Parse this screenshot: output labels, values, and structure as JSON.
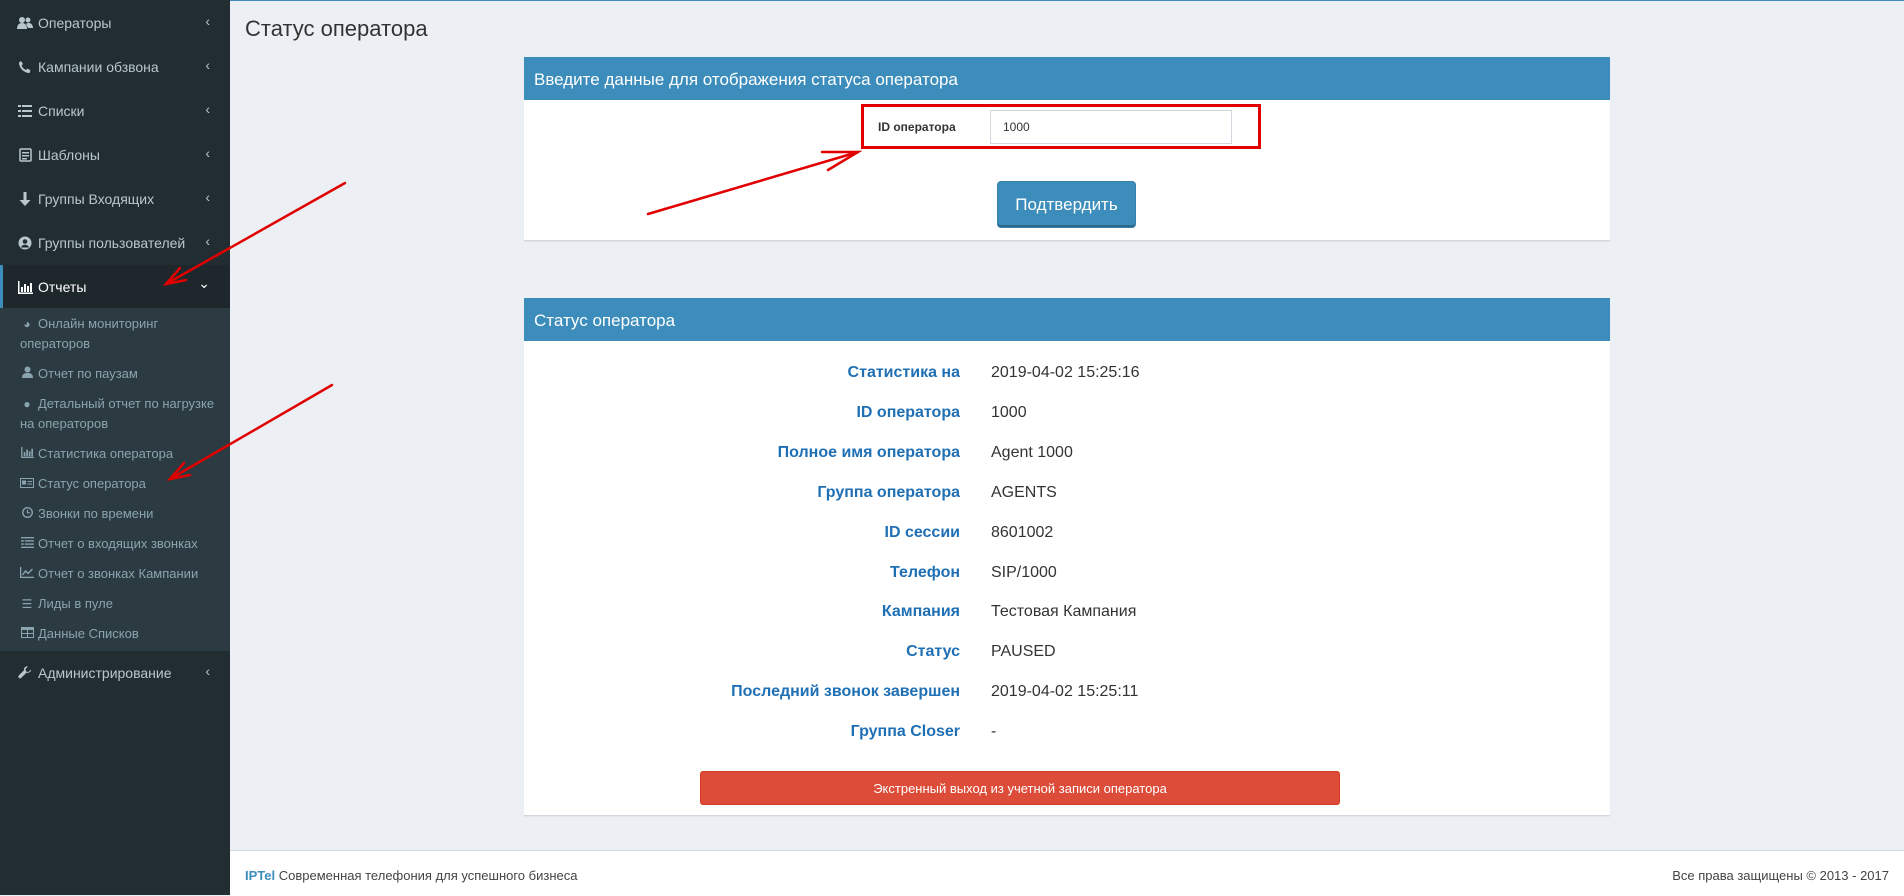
{
  "sidebar": {
    "items": [
      {
        "label": "Операторы",
        "icon": "users-icon"
      },
      {
        "label": "Кампании обзвона",
        "icon": "phone-icon"
      },
      {
        "label": "Списки",
        "icon": "list-icon"
      },
      {
        "label": "Шаблоны",
        "icon": "template-icon"
      },
      {
        "label": "Группы Входящих",
        "icon": "arrow-down-icon"
      },
      {
        "label": "Группы пользователей",
        "icon": "user-circle-icon"
      },
      {
        "label": "Отчеты",
        "icon": "bar-chart-icon",
        "active": true
      },
      {
        "label": "Администрирование",
        "icon": "wrench-icon"
      }
    ],
    "reports_submenu": [
      {
        "label": "Онлайн мониторинг операторов",
        "icon": "pie-chart-icon"
      },
      {
        "label": "Отчет по паузам",
        "icon": "user-icon"
      },
      {
        "label": "Детальный отчет по нагрузке на операторов",
        "icon": "circle-icon"
      },
      {
        "label": "Статистика оператора",
        "icon": "bar-chart-icon"
      },
      {
        "label": "Статус оператора",
        "icon": "id-card-icon"
      },
      {
        "label": "Звонки по времени",
        "icon": "clock-icon"
      },
      {
        "label": "Отчет о входящих звонках",
        "icon": "list-alt-icon"
      },
      {
        "label": "Отчет о звонках Кампании",
        "icon": "line-chart-icon"
      },
      {
        "label": "Лиды в пуле",
        "icon": "bars-icon"
      },
      {
        "label": "Данные Списков",
        "icon": "table-icon"
      }
    ]
  },
  "page": {
    "title": "Статус оператора"
  },
  "form": {
    "header": "Введите данные для отображения статуса оператора",
    "id_label": "ID оператора",
    "id_value": "1000",
    "submit_label": "Подтвердить"
  },
  "status": {
    "header": "Статус оператора",
    "rows": [
      {
        "label": "Статистика на",
        "value": "2019-04-02 15:25:16"
      },
      {
        "label": "ID оператора",
        "value": "1000"
      },
      {
        "label": "Полное имя оператора",
        "value": "Agent 1000"
      },
      {
        "label": "Группа оператора",
        "value": "AGENTS"
      },
      {
        "label": "ID сессии",
        "value": "8601002"
      },
      {
        "label": "Телефон",
        "value": "SIP/1000"
      },
      {
        "label": "Кампания",
        "value": "Тестовая Кампания"
      },
      {
        "label": "Статус",
        "value": "PAUSED"
      },
      {
        "label": "Последний звонок завершен",
        "value": "2019-04-02 15:25:11"
      },
      {
        "label": "Группа Closer",
        "value": "-"
      }
    ],
    "logout_label": "Экстренный выход из учетной записи оператора"
  },
  "footer": {
    "brand": "IPTel",
    "tagline": "Современная телефония для успешного бизнеса",
    "rights": "Все права защищены © 2013 - 2017"
  },
  "colors": {
    "accent": "#3c8dbc",
    "sidebar": "#222d32",
    "danger": "#dd4b39",
    "annotation": "#e10000"
  }
}
